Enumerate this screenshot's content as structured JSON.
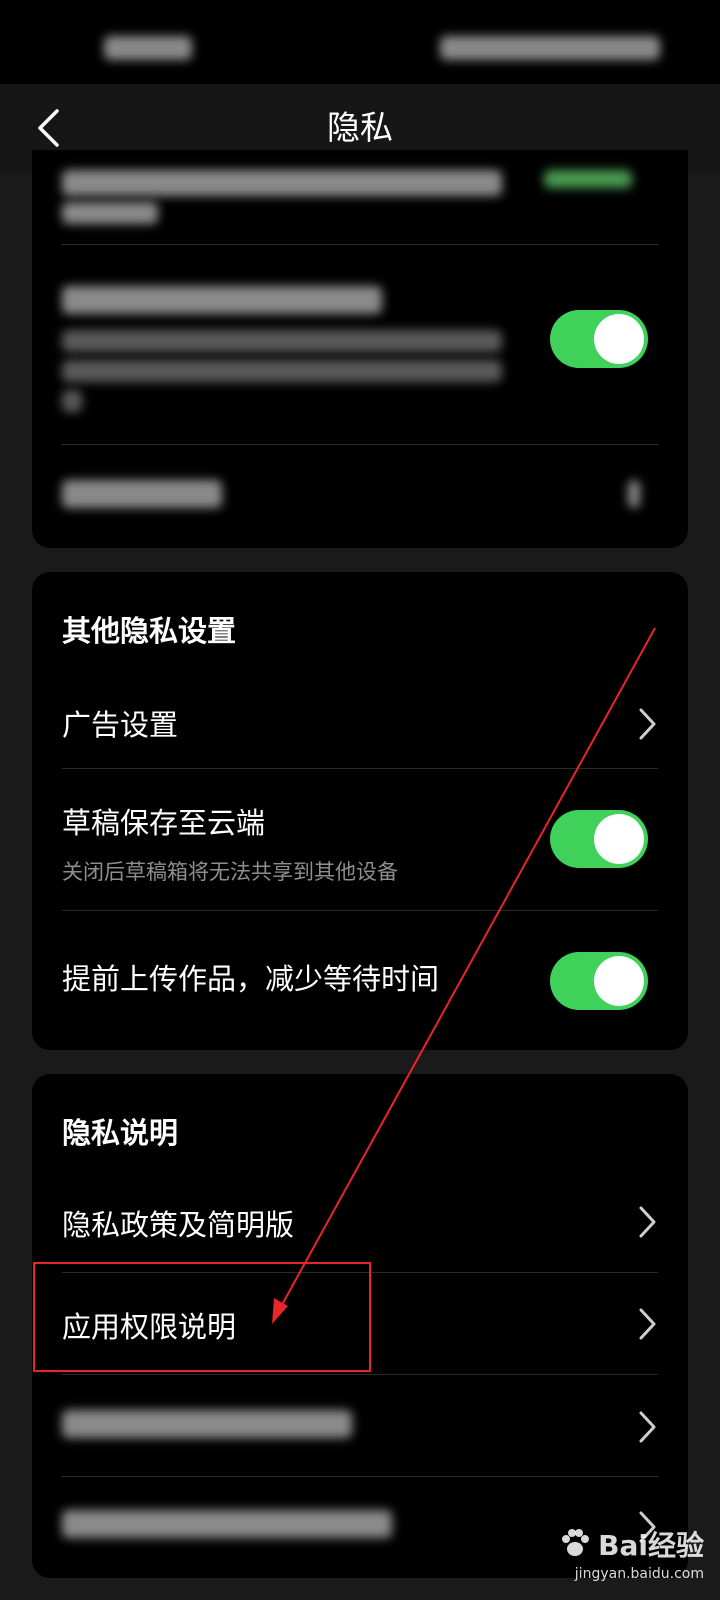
{
  "header": {
    "title": "隐私",
    "back_icon": "chevron-left-icon"
  },
  "sections": {
    "other": {
      "title": "其他隐私设置",
      "ad_settings": "广告设置",
      "draft_cloud": {
        "title": "草稿保存至云端",
        "subtitle": "关闭后草稿箱将无法共享到其他设备",
        "on": true
      },
      "pre_upload": {
        "title": "提前上传作品，减少等待时间",
        "on": true
      }
    },
    "privacy_info": {
      "title": "隐私说明",
      "policy": "隐私政策及简明版",
      "app_permissions": "应用权限说明"
    }
  },
  "colors": {
    "toggle_on": "#3fd15a",
    "card_bg": "#000000",
    "page_bg": "#1a1a1a",
    "annotation": "#e8252b"
  },
  "watermark": {
    "brand": "Bai经验",
    "url": "jingyan.baidu.com"
  }
}
